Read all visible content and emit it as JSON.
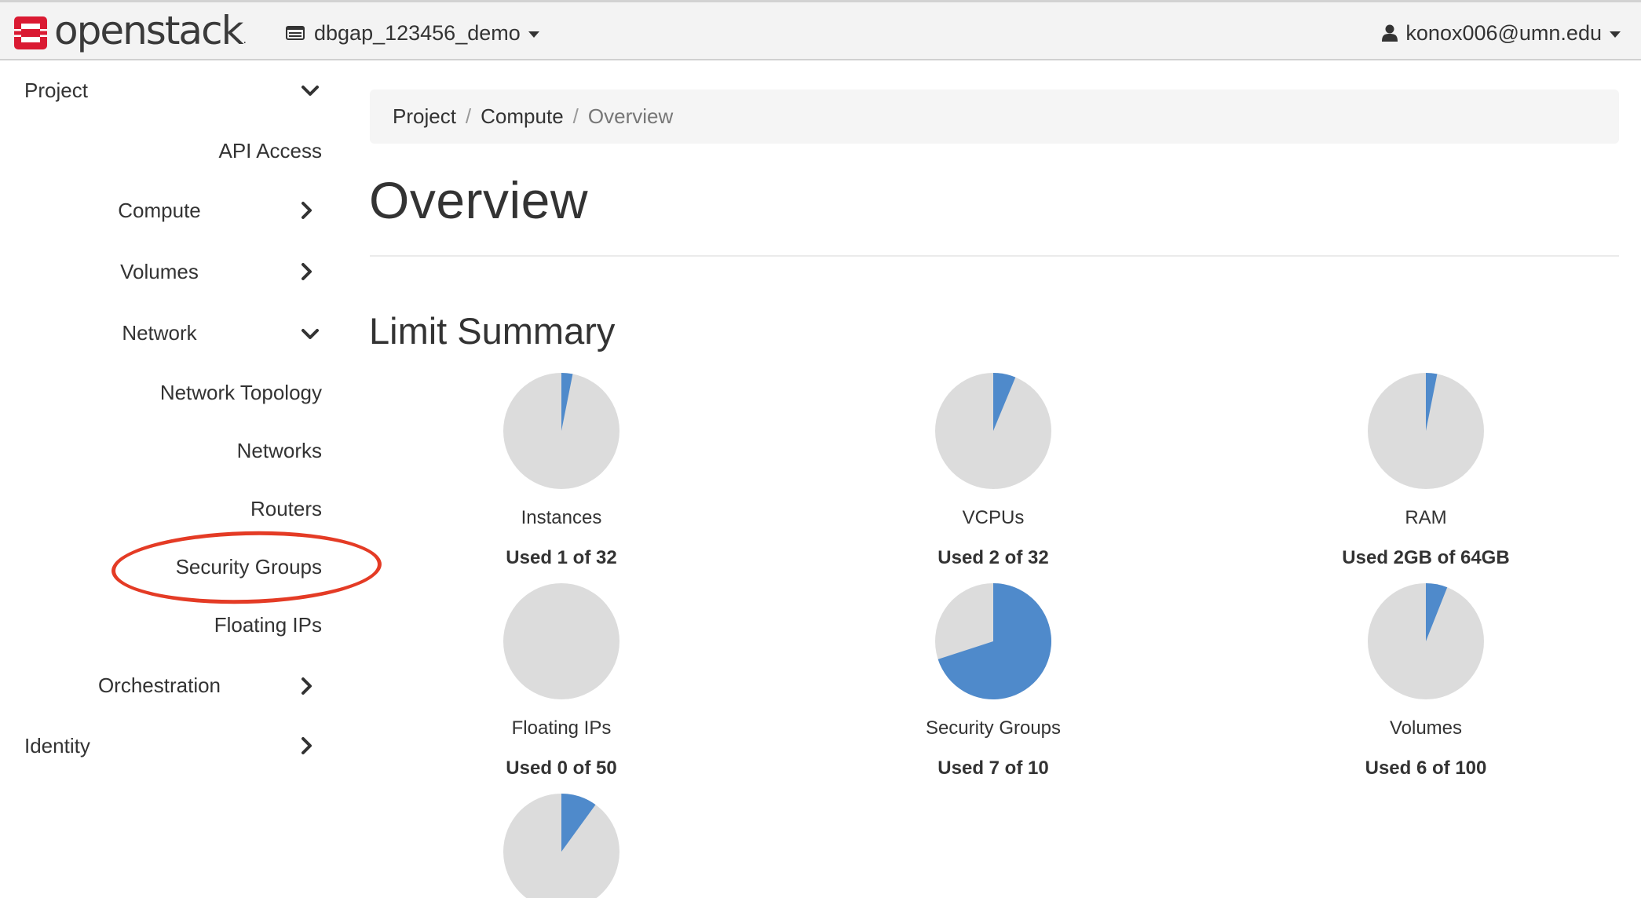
{
  "brand": {
    "name": "openstack",
    "mark": ".",
    "logo_color": "#da1a32"
  },
  "header": {
    "project_name": "dbgap_123456_demo",
    "user_name": "konox006@umn.edu"
  },
  "sidebar": {
    "project": "Project",
    "api_access": "API Access",
    "compute": "Compute",
    "volumes": "Volumes",
    "network": "Network",
    "network_topology": "Network Topology",
    "networks": "Networks",
    "routers": "Routers",
    "security_groups": "Security Groups",
    "floating_ips": "Floating IPs",
    "orchestration": "Orchestration",
    "identity": "Identity"
  },
  "breadcrumb": {
    "items": [
      "Project",
      "Compute",
      "Overview"
    ],
    "separator": "/"
  },
  "page": {
    "title": "Overview",
    "section_title": "Limit Summary"
  },
  "colors": {
    "pie_used": "#4f8acb",
    "pie_free": "#dcdcdc",
    "annotation": "#e43b25"
  },
  "chart_data": {
    "type": "pie",
    "charts": [
      {
        "label": "Instances",
        "usage_text": "Used 1 of 32",
        "used": 1,
        "total": 32
      },
      {
        "label": "VCPUs",
        "usage_text": "Used 2 of 32",
        "used": 2,
        "total": 32
      },
      {
        "label": "RAM",
        "usage_text": "Used 2GB of 64GB",
        "used": 2,
        "total": 64
      },
      {
        "label": "Floating IPs",
        "usage_text": "Used 0 of 50",
        "used": 0,
        "total": 50
      },
      {
        "label": "Security Groups",
        "usage_text": "Used 7 of 10",
        "used": 7,
        "total": 10
      },
      {
        "label": "Volumes",
        "usage_text": "Used 6 of 100",
        "used": 6,
        "total": 100
      },
      {
        "label": "",
        "usage_text": "",
        "used": 1,
        "total": 10
      }
    ]
  }
}
